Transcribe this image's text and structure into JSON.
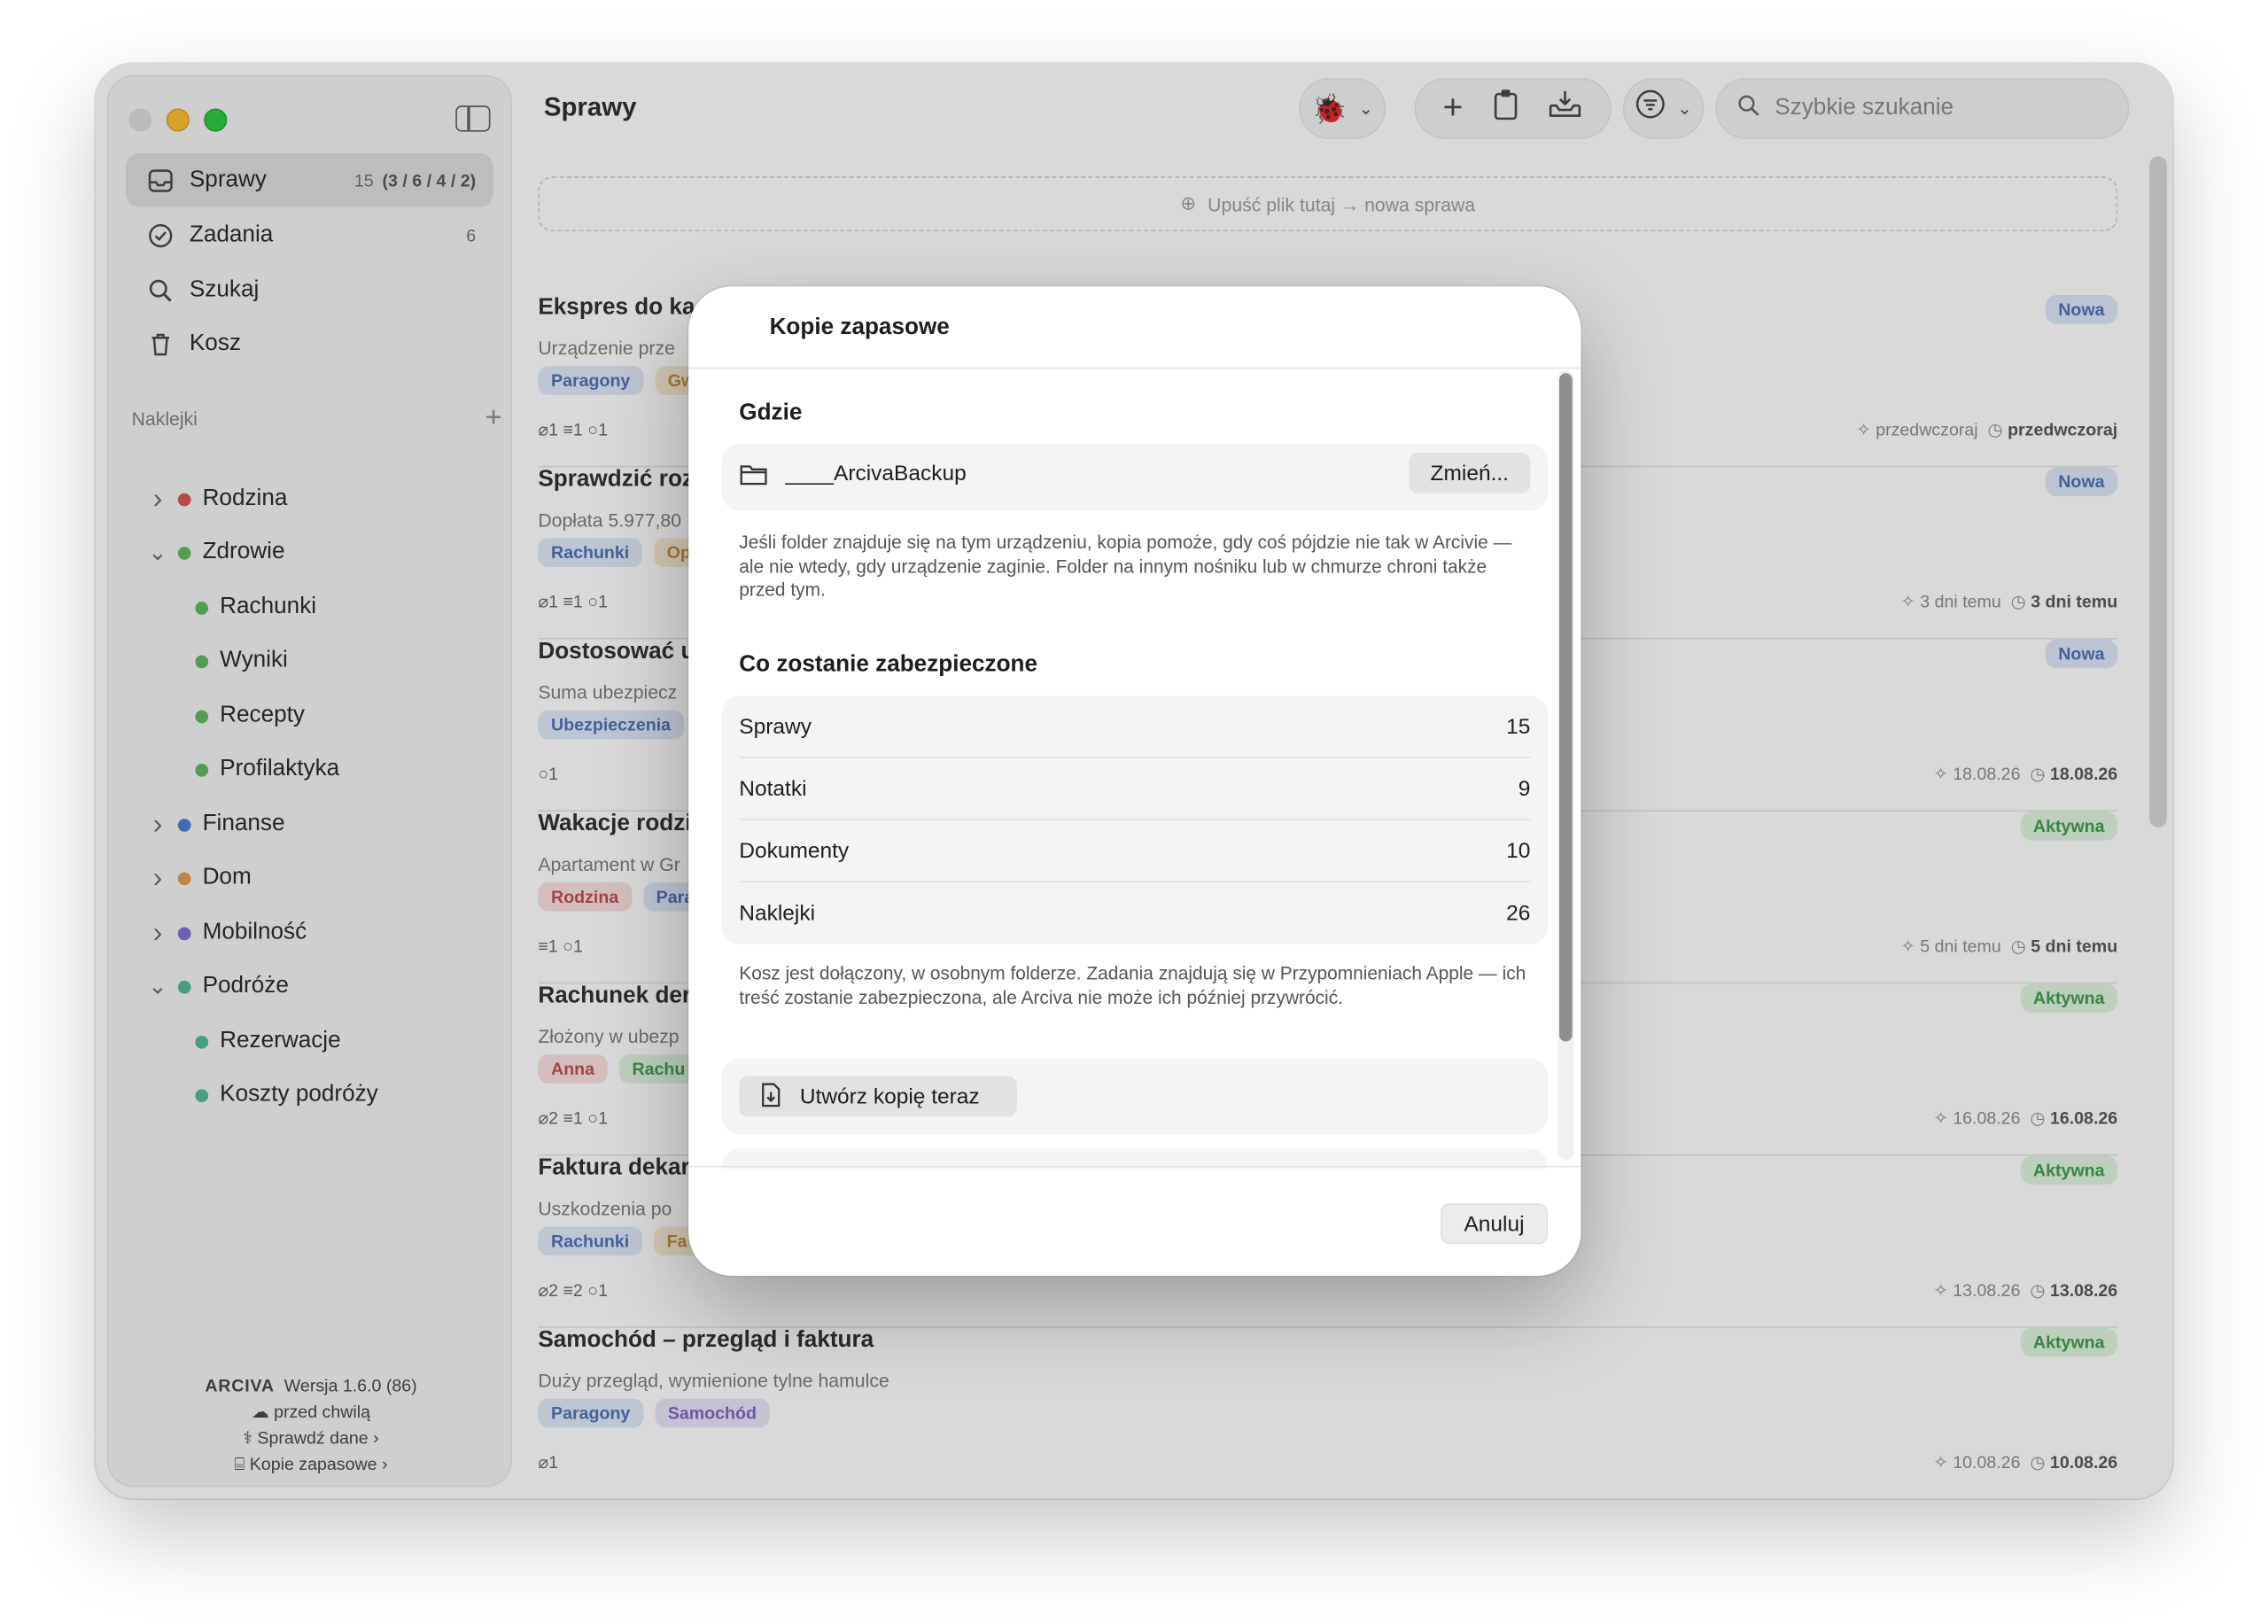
{
  "window": {
    "title": "Sprawy"
  },
  "sidebar": {
    "nav": [
      {
        "label": "Sprawy",
        "count": "15",
        "detail": "(3 / 6 / 4 / 2)"
      },
      {
        "label": "Zadania",
        "count": "6"
      },
      {
        "label": "Szukaj"
      },
      {
        "label": "Kosz"
      }
    ],
    "stickers_header": "Naklejki",
    "tree": [
      {
        "label": "Rodzina",
        "color": "#d9534f",
        "expanded": false,
        "level": 0
      },
      {
        "label": "Zdrowie",
        "color": "#5cb85c",
        "expanded": true,
        "level": 0
      },
      {
        "label": "Rachunki",
        "color": "#5cb85c",
        "level": 1
      },
      {
        "label": "Wyniki",
        "color": "#5cb85c",
        "level": 1
      },
      {
        "label": "Recepty",
        "color": "#5cb85c",
        "level": 1
      },
      {
        "label": "Profilaktyka",
        "color": "#5cb85c",
        "level": 1
      },
      {
        "label": "Finanse",
        "color": "#4a7bd0",
        "expanded": false,
        "level": 0
      },
      {
        "label": "Dom",
        "color": "#e09a4a",
        "expanded": false,
        "level": 0
      },
      {
        "label": "Mobilność",
        "color": "#7a6fd0",
        "expanded": false,
        "level": 0
      },
      {
        "label": "Podróże",
        "color": "#4fb89b",
        "expanded": true,
        "level": 0
      },
      {
        "label": "Rezerwacje",
        "color": "#4fb89b",
        "level": 1
      },
      {
        "label": "Koszty podróży",
        "color": "#4fb89b",
        "level": 1
      }
    ],
    "footer": {
      "brand": "ARCIVA",
      "version": "Wersja 1.6.0 (86)",
      "sync": "przed chwilą",
      "check": "Sprawdź dane",
      "backups": "Kopie zapasowe"
    }
  },
  "toolbar": {
    "search_placeholder": "Szybkie szukanie"
  },
  "dropzone": "Upuść plik tutaj → nowa sprawa",
  "cases": [
    {
      "title": "Ekspres do ka",
      "subtitle": "Urządzenie prze",
      "tags": [
        {
          "label": "Paragony",
          "bg": "#dfe7f8",
          "fg": "#4a6fb5"
        },
        {
          "label": "Gw",
          "bg": "#f8ead3",
          "fg": "#c08a3a"
        }
      ],
      "meta": "⌀1  ≡1  ○1",
      "status": "Nowa",
      "status_bg": "#dce6f8",
      "status_fg": "#4a6fb5",
      "created": "przedwczoraj",
      "modified": "przedwczoraj"
    },
    {
      "title": "Sprawdzić roz",
      "subtitle": "Dopłata 5.977,80",
      "tags": [
        {
          "label": "Rachunki",
          "bg": "#dfe7f8",
          "fg": "#4a6fb5"
        },
        {
          "label": "Op",
          "bg": "#f8ead3",
          "fg": "#c08a3a"
        }
      ],
      "meta": "⌀1  ≡1  ○1",
      "status": "Nowa",
      "status_bg": "#dce6f8",
      "status_fg": "#4a6fb5",
      "created": "3 dni temu",
      "modified": "3 dni temu"
    },
    {
      "title": "Dostosować u",
      "subtitle": "Suma ubezpiecz",
      "tags": [
        {
          "label": "Ubezpieczenia",
          "bg": "#dfe7f8",
          "fg": "#4a6fb5"
        }
      ],
      "meta": "○1",
      "status": "Nowa",
      "status_bg": "#dce6f8",
      "status_fg": "#4a6fb5",
      "created": "18.08.26",
      "modified": "18.08.26"
    },
    {
      "title": "Wakacje rodzi",
      "subtitle": "Apartament w Gr",
      "tags": [
        {
          "label": "Rodzina",
          "bg": "#f8dede",
          "fg": "#c24a4a"
        },
        {
          "label": "Para",
          "bg": "#dfe7f8",
          "fg": "#4a6fb5"
        }
      ],
      "meta": "≡1  ○1",
      "status": "Aktywna",
      "status_bg": "#dff3df",
      "status_fg": "#3d9a4a",
      "created": "5 dni temu",
      "modified": "5 dni temu"
    },
    {
      "title": "Rachunek der",
      "subtitle": "Złożony w ubezp",
      "tags": [
        {
          "label": "Anna",
          "bg": "#f8dede",
          "fg": "#c24a4a"
        },
        {
          "label": "Rachu",
          "bg": "#dff3df",
          "fg": "#3d9a4a"
        }
      ],
      "meta": "⌀2  ≡1  ○1",
      "status": "Aktywna",
      "status_bg": "#dff3df",
      "status_fg": "#3d9a4a",
      "created": "16.08.26",
      "modified": "16.08.26"
    },
    {
      "title": "Faktura dekar",
      "subtitle": "Uszkodzenia po",
      "tags": [
        {
          "label": "Rachunki",
          "bg": "#dfe7f8",
          "fg": "#4a6fb5"
        },
        {
          "label": "Fa",
          "bg": "#f8ead3",
          "fg": "#c08a3a"
        }
      ],
      "meta": "⌀2  ≡2  ○1",
      "status": "Aktywna",
      "status_bg": "#dff3df",
      "status_fg": "#3d9a4a",
      "created": "13.08.26",
      "modified": "13.08.26"
    },
    {
      "title": "Samochód – przegląd i faktura",
      "subtitle": "Duży przegląd, wymienione tylne hamulce",
      "tags": [
        {
          "label": "Paragony",
          "bg": "#dfe7f8",
          "fg": "#4a6fb5"
        },
        {
          "label": "Samochód",
          "bg": "#e9e4f8",
          "fg": "#7a62c2"
        }
      ],
      "meta": "⌀1",
      "status": "Aktywna",
      "status_bg": "#dff3df",
      "status_fg": "#3d9a4a",
      "created": "10.08.26",
      "modified": "10.08.26"
    }
  ],
  "modal": {
    "title": "Kopie zapasowe",
    "where_heading": "Gdzie",
    "folder": "____ArcivaBackup",
    "change_button": "Zmień...",
    "where_note": "Jeśli folder znajduje się na tym urządzeniu, kopia pomoże, gdy coś pójdzie nie tak w Arcivie — ale nie wtedy, gdy urządzenie zaginie. Folder na innym nośniku lub w chmurze chroni także przed tym.",
    "protected_heading": "Co zostanie zabezpieczone",
    "items": [
      {
        "label": "Sprawy",
        "value": "15"
      },
      {
        "label": "Notatki",
        "value": "9"
      },
      {
        "label": "Dokumenty",
        "value": "10"
      },
      {
        "label": "Naklejki",
        "value": "26"
      }
    ],
    "protected_note": "Kosz jest dołączony, w osobnym folderze. Zadania znajdują się w Przypomnieniach Apple — ich treść zostanie zabezpieczona, ale Arciva nie może ich później przywrócić.",
    "backup_now_button": "Utwórz kopię teraz",
    "cancel_button": "Anuluj"
  }
}
